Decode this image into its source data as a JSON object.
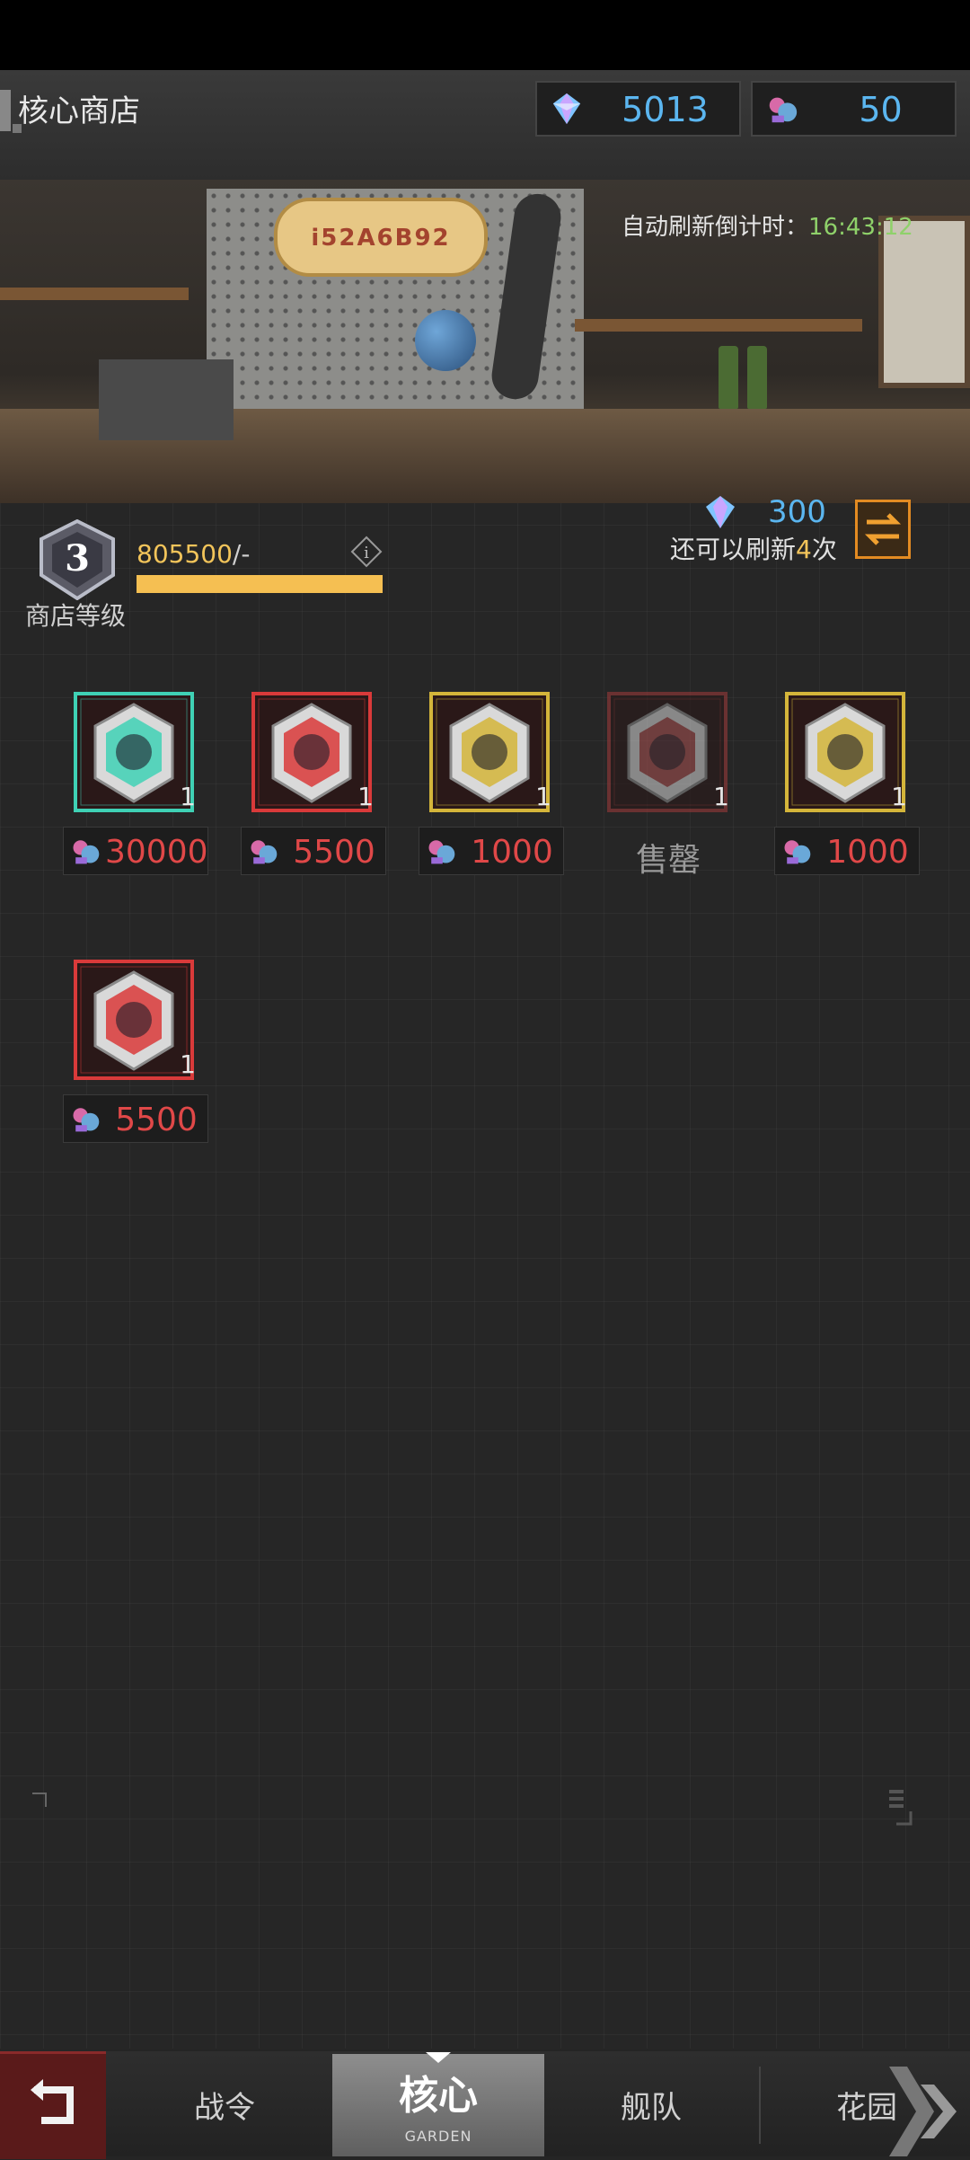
{
  "header": {
    "title": "核心商店",
    "currencies": [
      {
        "icon": "crystal-gem-icon",
        "value": "5013"
      },
      {
        "icon": "core-parts-icon",
        "value": "50"
      }
    ]
  },
  "scene": {
    "sign_text": "i52A6B92",
    "timer_label": "自动刷新倒计时：",
    "timer_value": "16:43:12"
  },
  "level": {
    "number": "3",
    "label": "商店等级",
    "exp": "805500",
    "exp_suffix": "/-",
    "exp_progress": 1.0
  },
  "refresh": {
    "cost": "300",
    "prefix": "还可以刷新",
    "count": "4",
    "suffix": "次"
  },
  "items": [
    {
      "qty": "1",
      "price": "30000",
      "sold_out": false,
      "frame_color": "#3fd1b5",
      "icon": "purple-core-badge-icon"
    },
    {
      "qty": "1",
      "price": "5500",
      "sold_out": false,
      "frame_color": "#d93a3a",
      "icon": "blue-figure-badge-icon"
    },
    {
      "qty": "1",
      "price": "1000",
      "sold_out": false,
      "frame_color": "#d4b53a",
      "icon": "green-sword-badge-icon"
    },
    {
      "qty": "1",
      "price": "",
      "sold_out": true,
      "soldout_text": "售罄",
      "frame_color": "#a33a3a",
      "icon": "wrench-badge-icon"
    },
    {
      "qty": "1",
      "price": "1000",
      "sold_out": false,
      "frame_color": "#d4b53a",
      "icon": "cat-badge-icon"
    },
    {
      "qty": "1",
      "price": "5500",
      "sold_out": false,
      "frame_color": "#d93a3a",
      "icon": "sword-badge-icon"
    }
  ],
  "nav": {
    "back_icon": "back-arrow-icon",
    "tabs": [
      "战令",
      "核心",
      "舰队",
      "花园"
    ],
    "active": "核心",
    "active_sub": "GARDEN"
  }
}
